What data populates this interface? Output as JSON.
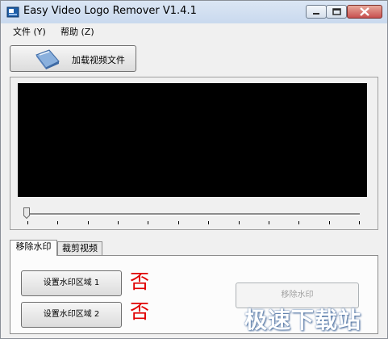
{
  "window": {
    "title": "Easy Video Logo Remover V1.4.1"
  },
  "menu": {
    "file": "文件 (Y)",
    "help": "帮助 (Z)"
  },
  "toolbar": {
    "load_label": "加载视频文件"
  },
  "player": {
    "position": 0
  },
  "tabs": [
    {
      "label": "移除水印"
    },
    {
      "label": "裁剪视频"
    }
  ],
  "panel": {
    "area1_label": "设置水印区域 1",
    "area2_label": "设置水印区域 2",
    "area1_status": "否",
    "area2_status": "否",
    "remove_label": "移除水印"
  },
  "watermark": {
    "text": "极速下载站"
  },
  "colors": {
    "status": "#e00000",
    "screen": "#000000"
  },
  "icons": {
    "app": "app-icon",
    "load": "film-file-icon"
  }
}
